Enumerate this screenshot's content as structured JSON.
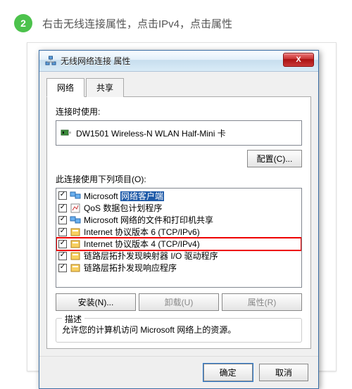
{
  "step": {
    "number": "2",
    "text": "右击无线连接属性，点击IPv4，点击属性"
  },
  "dialog": {
    "title": "无线网络连接 属性",
    "close": "X",
    "tabs": [
      "网络",
      "共享"
    ],
    "conn_label": "连接时使用:",
    "adapter": "DW1501 Wireless-N WLAN Half-Mini 卡",
    "configure_btn": "配置(C)...",
    "items_label": "此连接使用下列项目(O):",
    "items": [
      {
        "checked": true,
        "label_pre": "Microsoft ",
        "label_sel": "网络客户端",
        "label_post": "",
        "icon": "client",
        "highlighted": true
      },
      {
        "checked": true,
        "label": "QoS 数据包计划程序",
        "icon": "qos"
      },
      {
        "checked": true,
        "label": "Microsoft 网络的文件和打印机共享",
        "icon": "client"
      },
      {
        "checked": true,
        "label": "Internet 协议版本 6 (TCP/IPv6)",
        "icon": "proto"
      },
      {
        "checked": true,
        "label": "Internet 协议版本 4 (TCP/IPv4)",
        "icon": "proto",
        "redbox": true
      },
      {
        "checked": true,
        "label": "链路层拓扑发现映射器 I/O 驱动程序",
        "icon": "proto"
      },
      {
        "checked": true,
        "label": "链路层拓扑发现响应程序",
        "icon": "proto"
      }
    ],
    "install_btn": "安装(N)...",
    "uninstall_btn": "卸载(U)",
    "properties_btn": "属性(R)",
    "desc_group": "描述",
    "desc_text": "允许您的计算机访问 Microsoft 网络上的资源。",
    "ok_btn": "确定",
    "cancel_btn": "取消"
  }
}
